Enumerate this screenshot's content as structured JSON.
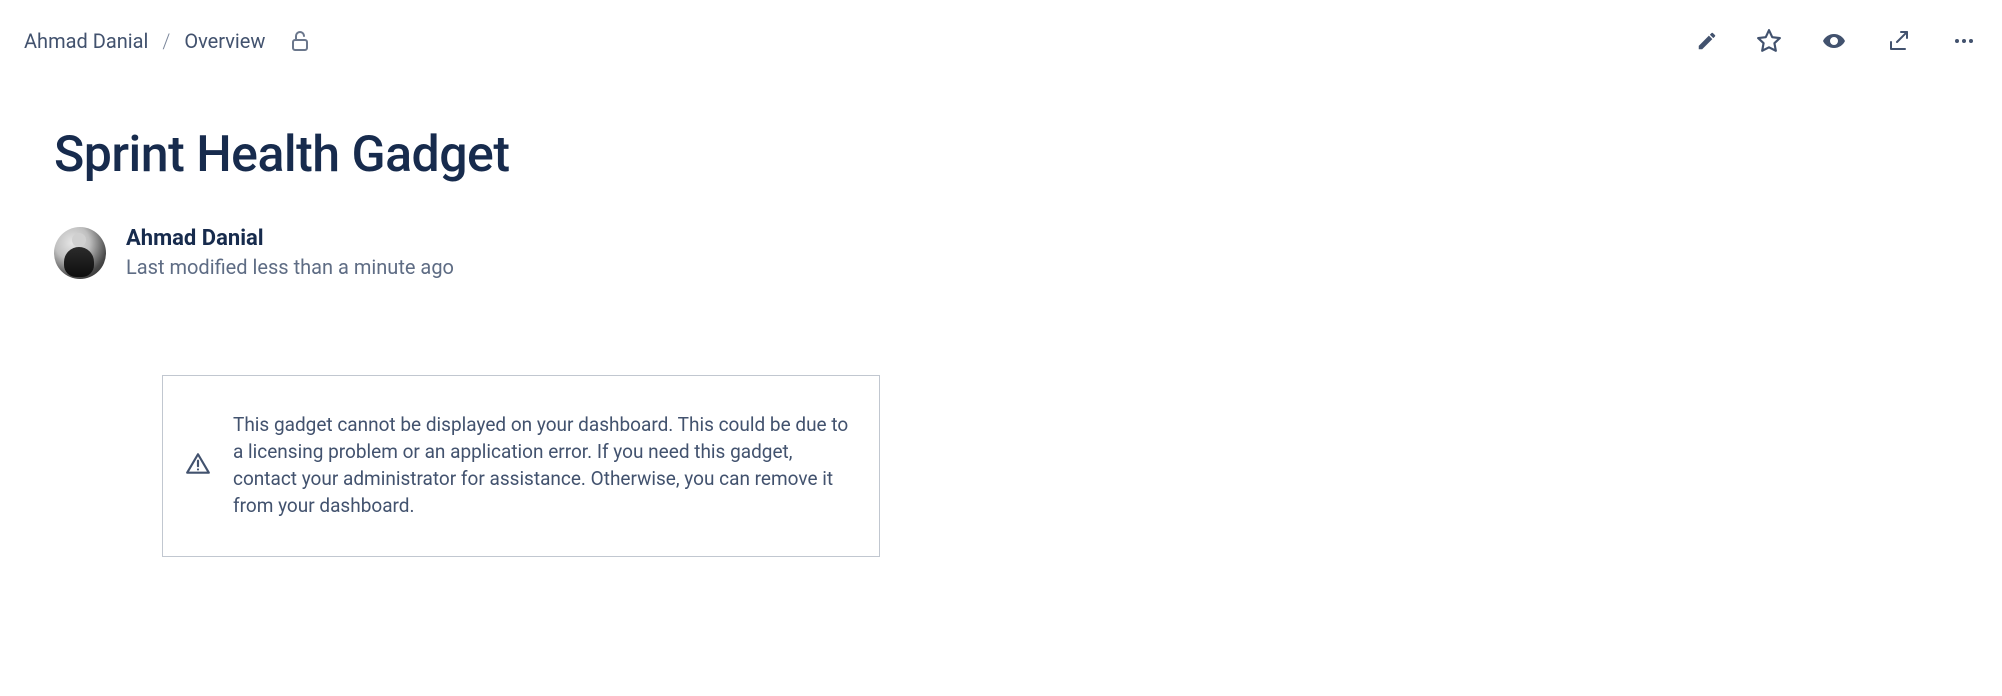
{
  "breadcrumb": {
    "space": "Ahmad Danial",
    "separator": "/",
    "page": "Overview"
  },
  "title": "Sprint Health Gadget",
  "byline": {
    "author": "Ahmad Danial",
    "modified": "Last modified less than a minute ago"
  },
  "gadget": {
    "message": "This gadget cannot be displayed on your dashboard. This could be due to a licensing problem or an application error. If you need this gadget, contact your administrator for assistance. Otherwise, you can remove it from your dashboard."
  }
}
